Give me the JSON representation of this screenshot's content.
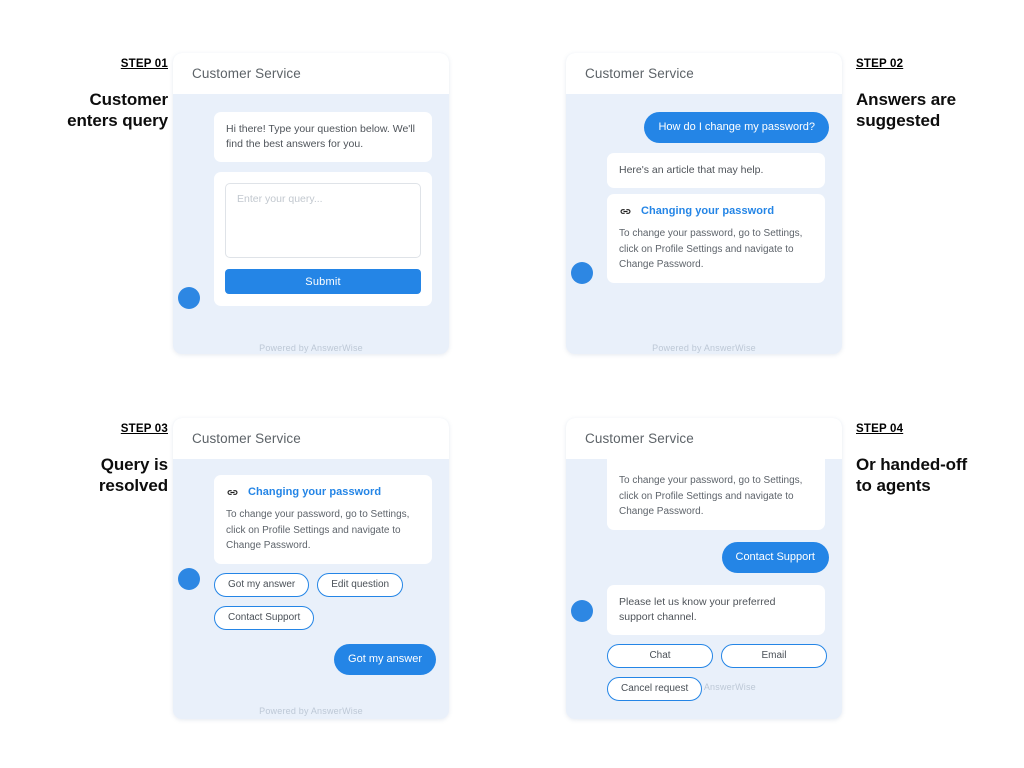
{
  "brand": {
    "accent": "#2485e6",
    "panel_bg": "#e9f0fa",
    "widget_title": "Customer Service",
    "footer": "Powered by AnswerWise",
    "link_icon": "link-icon"
  },
  "steps": [
    {
      "kicker": "STEP 01",
      "title": "Customer\nenters query",
      "title_line1": "Customer",
      "title_line2": "enters query",
      "header": "Customer Service",
      "greeting": "Hi there! Type your question below. We'll find the best answers for you.",
      "input_placeholder": "Enter your query...",
      "input_value": "",
      "submit_label": "Submit",
      "footer": "Powered by AnswerWise"
    },
    {
      "kicker": "STEP 02",
      "title_line1": "Answers are",
      "title_line2": "suggested",
      "header": "Customer Service",
      "user_message": "How do I change my password?",
      "bot_message": "Here's an article that may help.",
      "article_title": "Changing your password",
      "article_body": "To change your password, go to Settings, click on Profile Settings and navigate to Change Password.",
      "footer": "Powered by AnswerWise"
    },
    {
      "kicker": "STEP 03",
      "title_line1": "Query is",
      "title_line2": "resolved",
      "header": "Customer Service",
      "article_title": "Changing your password",
      "article_body": "To change your password, go to Settings, click on Profile Settings and navigate to Change Password.",
      "chips": [
        "Got my answer",
        "Edit question",
        "Contact Support"
      ],
      "user_message": "Got my answer",
      "footer": "Powered by AnswerWise"
    },
    {
      "kicker": "STEP 04",
      "title_line1": "Or handed-off",
      "title_line2": "to agents",
      "header": "Customer Service",
      "article_body": "To change your password, go to Settings, click on Profile Settings and navigate to Change Password.",
      "user_message": "Contact Support",
      "bot_message": "Please let us know your preferred support channel.",
      "chips": [
        "Chat",
        "Email",
        "Cancel request"
      ],
      "footer": "Powered by AnswerWise"
    }
  ]
}
